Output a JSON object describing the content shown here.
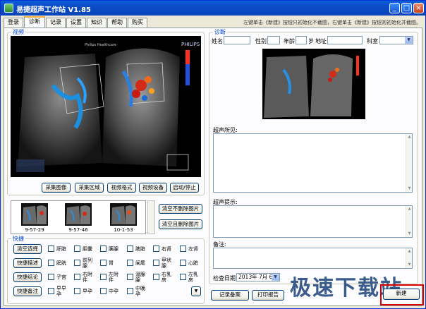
{
  "window": {
    "title": "易捷超声工作站 V1.85",
    "minimize": "_",
    "maximize": "□",
    "close": "×"
  },
  "tabs": [
    "登录",
    "诊断",
    "记录",
    "设置",
    "知识",
    "帮助",
    "购买"
  ],
  "active_tab": "诊断",
  "hint": "左键单击《新建》按钮只初始化不截图，右键单击《新建》按钮则初始化并截图。",
  "video": {
    "group_label": "视频",
    "brand": "PHILIPS",
    "caption": "Philips Healthcare",
    "buttons": [
      "采集图像",
      "采集区域",
      "视频格式",
      "视频设备",
      "启动/停止"
    ]
  },
  "thumbnails": [
    {
      "caption": "9-57-29"
    },
    {
      "caption": "9-57-46"
    },
    {
      "caption": "10-1-53"
    }
  ],
  "thumb_buttons": {
    "clear_keep": "清空不删除图片",
    "clear_delete": "清空且删除图片"
  },
  "shortcuts": {
    "group_label": "快捷",
    "side_buttons": [
      "清空选择",
      "快捷描述",
      "快捷结论",
      "快捷备注"
    ],
    "checkboxes": [
      [
        "肝脏",
        "胆囊",
        "胰腺",
        "脾脏",
        "右肾",
        "左肾"
      ],
      [
        "膀胱",
        "前列\n腺",
        "胃",
        "阑尾",
        "甲状\n腺",
        "心脏"
      ],
      [
        "子宫",
        "右附\n件",
        "左附\n件",
        "涎腺\n腺",
        "右乳\n房",
        "左乳\n房"
      ],
      [
        "早早\n孕",
        "早孕",
        "中孕",
        "中晚\n孕"
      ]
    ],
    "more_arrow": "▼"
  },
  "diagnosis": {
    "group_label": "诊断",
    "name_label": "姓名",
    "gender_label": "性别",
    "age_label": "年龄",
    "age_unit": "岁",
    "address_label": "地址",
    "dept_label": "科室",
    "findings_label": "超声所见:",
    "prompt_label": "超声提示:",
    "remark_label": "备注:",
    "date_label": "检查日期",
    "date_value": "2013年 7月 6日",
    "buttons": {
      "save": "记录备案",
      "print": "打印报告",
      "new": "新建"
    }
  },
  "watermark": "极速下载站",
  "colors": {
    "titlebar": "#0a5fd8",
    "tab_highlight": "#f4b03c",
    "group_label": "#0046d5"
  }
}
